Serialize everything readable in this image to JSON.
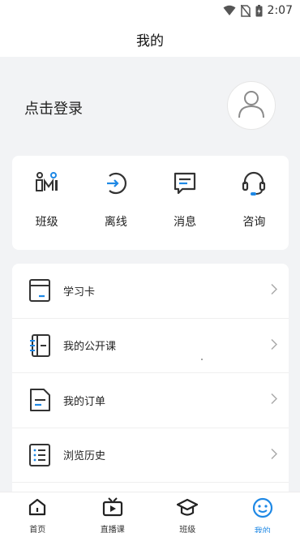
{
  "status_bar": {
    "time": "2:07"
  },
  "header": {
    "title": "我的"
  },
  "profile": {
    "login_text": "点击登录"
  },
  "shortcuts": [
    {
      "label": "班级",
      "icon": "class-icon"
    },
    {
      "label": "离线",
      "icon": "offline-download-icon"
    },
    {
      "label": "消息",
      "icon": "message-icon"
    },
    {
      "label": "咨询",
      "icon": "headset-icon"
    }
  ],
  "menu": [
    {
      "label": "学习卡",
      "icon": "study-card-icon"
    },
    {
      "label": "我的公开课",
      "icon": "public-course-icon"
    },
    {
      "label": "我的订单",
      "icon": "order-icon"
    },
    {
      "label": "浏览历史",
      "icon": "history-icon"
    }
  ],
  "tabbar": [
    {
      "label": "首页",
      "icon": "home-icon",
      "active": false
    },
    {
      "label": "直播课",
      "icon": "live-tv-icon",
      "active": false
    },
    {
      "label": "班级",
      "icon": "graduation-cap-icon",
      "active": false
    },
    {
      "label": "我的",
      "icon": "profile-icon",
      "active": true
    }
  ],
  "colors": {
    "accent": "#1e88e5",
    "icon_dark": "#333333",
    "background": "#f2f3f5"
  }
}
